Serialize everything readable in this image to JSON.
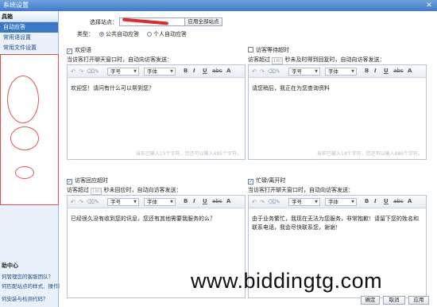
{
  "window": {
    "title": "系统设置",
    "close": "✕"
  },
  "sidebar": {
    "heading": "具箱",
    "items": [
      {
        "label": "自动应答",
        "active": true
      },
      {
        "label": "常用语设置",
        "active": false
      },
      {
        "label": "常用文件设置",
        "active": false
      }
    ],
    "help": {
      "title": "助中心",
      "links": [
        "何管理您的客服团队？",
        "何匹配站点的样式、操作行",
        "何安装与检测代码？"
      ]
    }
  },
  "main": {
    "site_label": "选择站点：",
    "apply_all_button": "应用全部站点",
    "type_label": "类型：",
    "type_options": [
      {
        "label": "公共自动应答",
        "selected": true
      },
      {
        "label": "个人自动应答",
        "selected": false
      }
    ],
    "cards": [
      {
        "title": "欢迎语",
        "checked": true,
        "sub_pre": "当访客打开聊天窗口时，自动向访客发送：",
        "seconds": "",
        "sub_post": "",
        "content": "欢迎您！请问有什么可以帮到您？",
        "counter": "当前已输入15个字符，您还可以输入485个字符。"
      },
      {
        "title": "访客等待超时",
        "checked": false,
        "sub_pre": "访客超过",
        "seconds": "180",
        "sub_post": "秒未及时得到回复时，自动向访客发送：",
        "content": "请您稍后，我正在为您查询资料",
        "counter": "当前已输入14个字符，您还可以输入486个字符。"
      },
      {
        "title": "访客回应超时",
        "checked": true,
        "sub_pre": "访客超过",
        "seconds": "180",
        "sub_post": "秒未回应时，自动向访客发送：",
        "content": "已经很久没有收到您的讯息，您还有其他需要我服务的么？",
        "counter": ""
      },
      {
        "title": "忙碌/离开时",
        "checked": true,
        "sub_pre": "当访客打开聊天窗口时，自动向访客发送：",
        "seconds": "",
        "sub_post": "",
        "content": "由于业务繁忙，我现在无法为您服务，非常抱歉！请留下您的姓名和联系电话，我会尽快联系您，谢谢！",
        "counter": ""
      }
    ],
    "toolbar": {
      "font_size": "字号",
      "font_family": "字体",
      "bold": "B",
      "italic": "I",
      "underline": "U",
      "strike": "abc",
      "color": "A"
    },
    "footer_buttons": [
      "确定",
      "取消",
      "应用"
    ]
  },
  "watermark": "www.biddingtg.com"
}
